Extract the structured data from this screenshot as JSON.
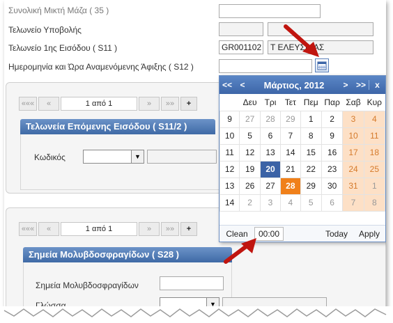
{
  "form": {
    "mass_label": "Συνολική Μικτή Μάζα ( 35 )",
    "office_submit_label": "Τελωνείο Υποβολής",
    "office_entry_label": "Τελωνείο 1ης Εισόδου ( S11 )",
    "office_entry_code": "GR001102",
    "office_entry_name": "Τ ΕΛΕΥΣΙΝΑΣ",
    "arrival_label": "Ημερομηνία και Ώρα Αναμενόμενης Άφιξης ( S12 )"
  },
  "section1": {
    "pager": {
      "first": "«««",
      "prev": "«",
      "info": "1 από 1",
      "next": "»",
      "last": "»»",
      "add": "+"
    },
    "band_title": "Τελωνεία Επόμενης Εισόδου ( S11/2 )",
    "code_label": "Κωδικός"
  },
  "section2": {
    "pager": {
      "first": "«««",
      "prev": "«",
      "info": "1 από 1",
      "next": "»",
      "last": "»»",
      "add": "+"
    },
    "band_title": "Σημεία Μολυβδοσφραγίδων ( S28 )",
    "seals_label": "Σημεία Μολυβδοσφραγίδων",
    "language_label": "Γλώσσα"
  },
  "calendar": {
    "prev_year": "<<",
    "prev_month": "<",
    "title": "Μάρτιος, 2012",
    "next_month": ">",
    "next_year": ">>",
    "close": "x",
    "weekdays": [
      "Δευ",
      "Τρι",
      "Τετ",
      "Πεμ",
      "Παρ",
      "Σαβ",
      "Κυρ"
    ],
    "weeks": [
      {
        "num": "9",
        "days": [
          "27",
          "28",
          "29",
          "1",
          "2",
          "3",
          "4"
        ]
      },
      {
        "num": "10",
        "days": [
          "5",
          "6",
          "7",
          "8",
          "9",
          "10",
          "11"
        ]
      },
      {
        "num": "11",
        "days": [
          "12",
          "13",
          "14",
          "15",
          "16",
          "17",
          "18"
        ]
      },
      {
        "num": "12",
        "days": [
          "19",
          "20",
          "21",
          "22",
          "23",
          "24",
          "25"
        ]
      },
      {
        "num": "13",
        "days": [
          "26",
          "27",
          "28",
          "29",
          "30",
          "31",
          "1"
        ]
      },
      {
        "num": "14",
        "days": [
          "2",
          "3",
          "4",
          "5",
          "6",
          "7",
          "8"
        ]
      }
    ],
    "clean_label": "Clean",
    "time_value": "00:00",
    "today_label": "Today",
    "apply_label": "Apply",
    "colors": {
      "header": "#3d66a8",
      "selected": "#3b63a6",
      "today": "#f0801a",
      "weekend_bg": "#fde0c6",
      "arrow": "#c0150f"
    }
  }
}
